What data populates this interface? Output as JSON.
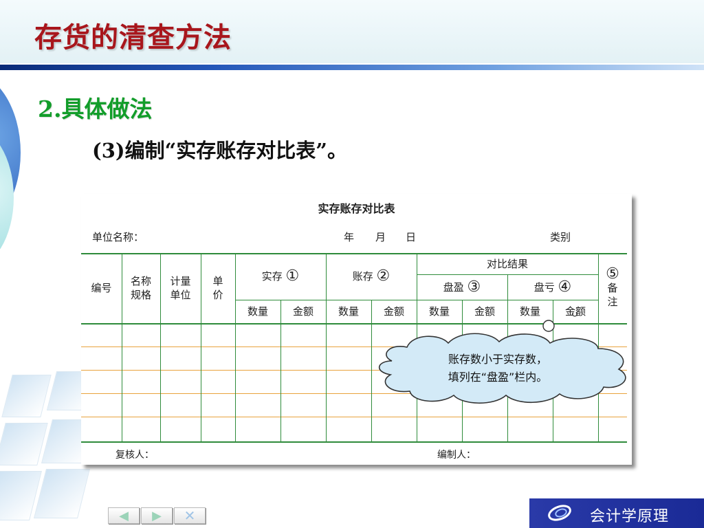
{
  "header": {
    "title": "存货的清查方法"
  },
  "section": {
    "heading": "2.具体做法",
    "subheading": "(3)编制“实存账存对比表”。"
  },
  "table": {
    "title": "实存账存对比表",
    "unit_label": "单位名称：",
    "date_labels": {
      "year": "年",
      "month": "月",
      "day": "日"
    },
    "category_label": "类别",
    "headers": {
      "number": "编号",
      "name_spec": [
        "名称",
        "规格"
      ],
      "unit": [
        "计量",
        "单位"
      ],
      "price": [
        "单",
        "价"
      ],
      "actual": "实存",
      "actual_mark": "①",
      "book": "账存",
      "book_mark": "②",
      "compare": "对比结果",
      "surplus": "盘盈",
      "surplus_mark": "③",
      "deficit": "盘亏",
      "deficit_mark": "④",
      "remark_mark": "⑤",
      "remark": [
        "备",
        "注"
      ],
      "qty": "数量",
      "amount": "金额"
    },
    "reviewer_label": "复核人：",
    "preparer_label": "编制人："
  },
  "callout": {
    "line1": "账存数小于实存数，",
    "line2": "填列在“盘盈”栏内。"
  },
  "nav": {
    "prev": "◀",
    "next": "▶",
    "close": "✕"
  },
  "brand": {
    "text": "会计学原理"
  },
  "colors": {
    "title": "#a8161c",
    "heading": "#129d2a",
    "table_green": "#2e8b3a",
    "row_orange": "#e8a23c",
    "brand": "#2a3aa8"
  }
}
